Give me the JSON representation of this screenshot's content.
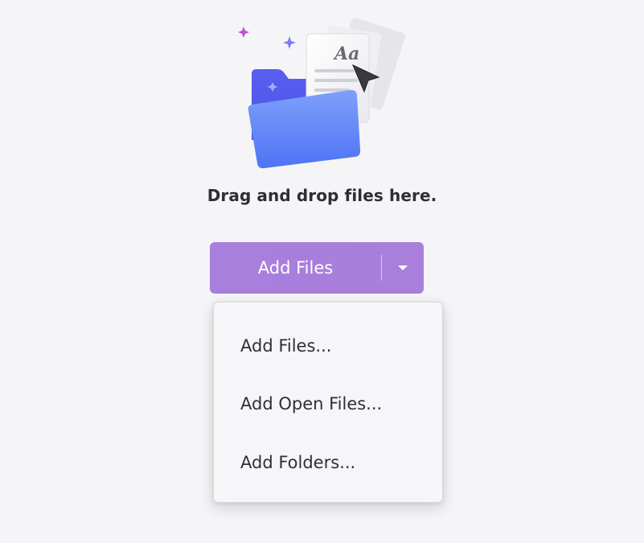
{
  "drop_zone": {
    "instruction": "Drag and drop files here.",
    "illustration_icon": "folder-documents-illustration"
  },
  "add_button": {
    "label": "Add Files",
    "arrow_icon": "caret-down-icon",
    "color": "#a97fdc"
  },
  "dropdown": {
    "items": [
      {
        "label": "Add Files..."
      },
      {
        "label": "Add Open Files..."
      },
      {
        "label": "Add Folders..."
      }
    ]
  }
}
